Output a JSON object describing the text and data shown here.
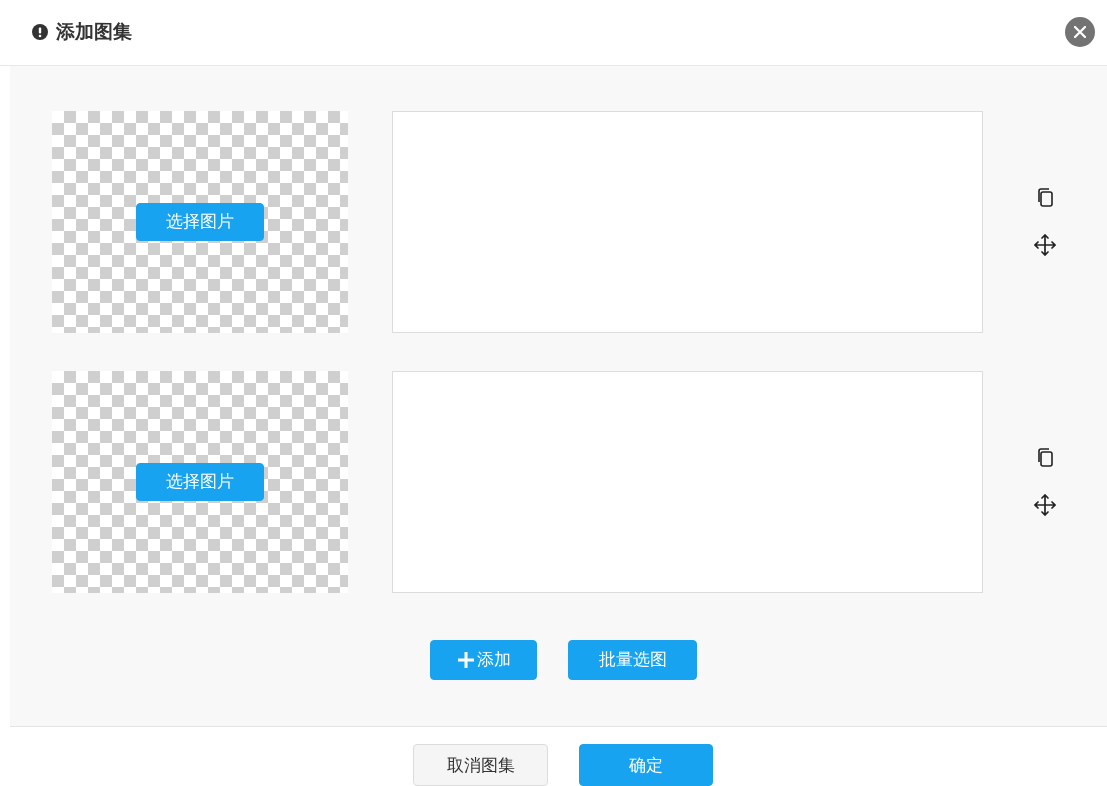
{
  "dialog": {
    "title": "添加图集"
  },
  "items": [
    {
      "select_button": "选择图片"
    },
    {
      "select_button": "选择图片"
    }
  ],
  "actions": [
    {
      "kind": "add",
      "label": "添加"
    },
    {
      "kind": "batch",
      "label": "批量选图"
    }
  ],
  "footer": [
    {
      "kind": "secondary",
      "label": "取消图集"
    },
    {
      "kind": "primary",
      "label": "确定"
    }
  ]
}
